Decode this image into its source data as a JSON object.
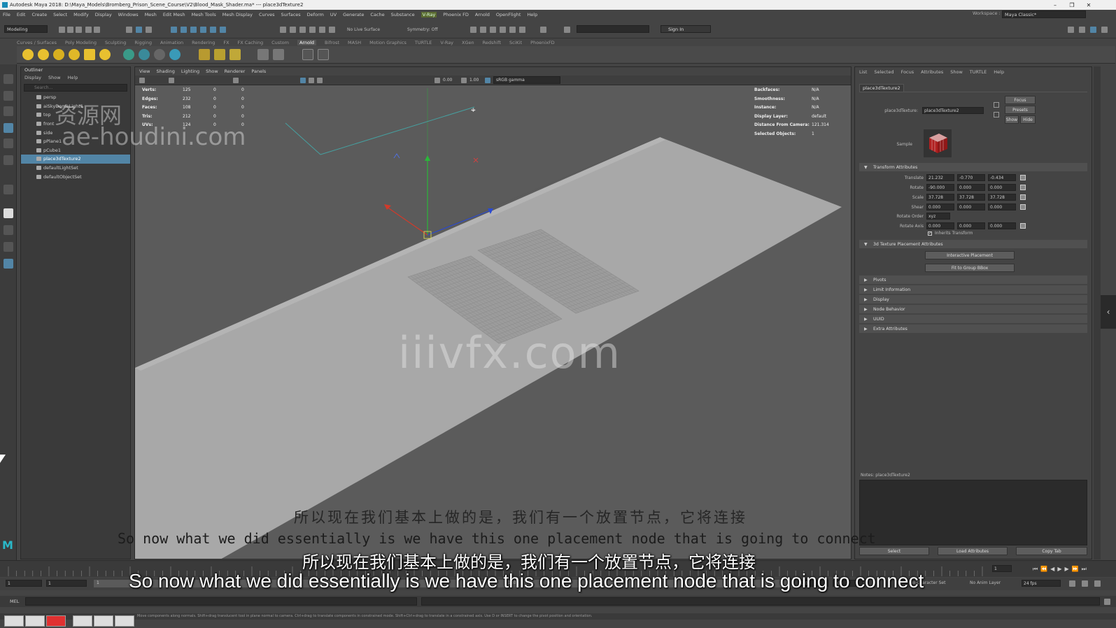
{
  "window": {
    "title": "Autodesk Maya 2018: D:\\Maya_Models\\Bromberg_Prison_Scene_Course\\V2\\Blood_Mask_Shader.ma*   ---   place3dTexture2"
  },
  "menubar": {
    "items": [
      "File",
      "Edit",
      "Create",
      "Select",
      "Modify",
      "Display",
      "Windows",
      "Mesh",
      "Edit Mesh",
      "Mesh Tools",
      "Mesh Display",
      "Curves",
      "Surfaces",
      "Deform",
      "UV",
      "Generate",
      "Cache",
      "Substance",
      "V-Ray",
      "Phoenix FD",
      "Arnold",
      "OpenFlight",
      "Help"
    ],
    "workspace_label": "Workspace :",
    "workspace_value": "Maya Classic*"
  },
  "toolbar": {
    "mode": "Modeling",
    "live_surface": "No Live Surface",
    "symmetry": "Symmetry: Off",
    "sign_in": "Sign In"
  },
  "shelf_tabs": [
    "Curves / Surfaces",
    "Poly Modeling",
    "Sculpting",
    "Rigging",
    "Animation",
    "Rendering",
    "FX",
    "FX Caching",
    "Custom",
    "Arnold",
    "Bifrost",
    "MASH",
    "Motion Graphics",
    "TURTLE",
    "V-Ray",
    "XGen",
    "Redshift",
    "SciKit",
    "PhoenixFD"
  ],
  "shelf_active": "Arnold",
  "outliner": {
    "title": "Outliner",
    "menu": [
      "Display",
      "Show",
      "Help"
    ],
    "search_placeholder": "Search...",
    "items": [
      "persp",
      "aiSkyDomeLight1",
      "top",
      "front",
      "side",
      "pPlane1",
      "pCube1",
      "place3dTexture2",
      "defaultLightSet",
      "defaultObjectSet"
    ],
    "selected": "place3dTexture2"
  },
  "viewport": {
    "menu": [
      "View",
      "Shading",
      "Lighting",
      "Show",
      "Renderer",
      "Panels"
    ],
    "exposure": "0.00",
    "gamma": "1.00",
    "color_space": "sRGB gamma",
    "hud_left": {
      "labels": [
        "Verts:",
        "Edges:",
        "Faces:",
        "Tris:",
        "UVs:"
      ],
      "col1": [
        "125",
        "232",
        "108",
        "212",
        "124"
      ],
      "col2": [
        "0",
        "0",
        "0",
        "0",
        "0"
      ],
      "col3": [
        "0",
        "0",
        "0",
        "0",
        "0"
      ]
    },
    "hud_right": {
      "labels": [
        "Backfaces:",
        "Smoothness:",
        "Instance:",
        "Display Layer:",
        "Distance From Camera:",
        "Selected Objects:"
      ],
      "values": [
        "N/A",
        "N/A",
        "N/A",
        "default",
        "121.314",
        "1"
      ]
    }
  },
  "watermarks": {
    "cn_site": "资源网",
    "site1": "ae-houdini.com",
    "site2": "iiivfx.com"
  },
  "attribute_editor": {
    "menu": [
      "List",
      "Selected",
      "Focus",
      "Attributes",
      "Show",
      "TURTLE",
      "Help"
    ],
    "tab": "place3dTexture2",
    "node_label": "place3dTexture:",
    "node_value": "place3dTexture2",
    "focus": "Focus",
    "presets": "Presets",
    "show": "Show",
    "hide": "Hide",
    "sample_label": "Sample",
    "transform_section": "Transform Attributes",
    "translate_label": "Translate",
    "translate": [
      "21.232",
      "-0.770",
      "-0.434"
    ],
    "rotate_label": "Rotate",
    "rotate": [
      "-90.000",
      "0.000",
      "0.000"
    ],
    "scale_label": "Scale",
    "scale": [
      "37.728",
      "37.728",
      "37.728"
    ],
    "shear_label": "Shear",
    "shear": [
      "0.000",
      "0.000",
      "0.000"
    ],
    "rotate_order_label": "Rotate Order",
    "rotate_order": "xyz",
    "rotate_axis_label": "Rotate Axis",
    "rotate_axis": [
      "0.000",
      "0.000",
      "0.000"
    ],
    "inherits_transform": "Inherits Transform",
    "placement_section": "3d Texture Placement Attributes",
    "interactive_placement": "Interactive Placement",
    "fit_to_group": "Fit to Group BBox",
    "collapsed_sections": [
      "Pivots",
      "Limit Information",
      "Display",
      "Node Behavior",
      "UUID",
      "Extra Attributes"
    ],
    "notes_label": "Notes: place3dTexture2",
    "select_btn": "Select",
    "load_attrs_btn": "Load Attributes",
    "copy_tab_btn": "Copy Tab"
  },
  "timeline": {
    "current_frame": "1",
    "range_start": "1",
    "range_inner_start": "1",
    "range_inner_end": "120",
    "range_end": "120",
    "range_end2": "200",
    "char_set": "No Character Set",
    "anim_layer": "No Anim Layer",
    "fps": "24 fps"
  },
  "cmdline": {
    "label": "MEL"
  },
  "helpline": {
    "text": "Move components along normals. Shift+drag translucent tool in plane normal to camera. Ctrl+drag to translate components in constrained mode. Shift+Ctrl+drag to translate in a constrained axis. Use D or INSERT to change the pivot position and orientation."
  },
  "subtitles": {
    "cn_top": "所以现在我们基本上做的是，我们有一个放置节点，它将连接",
    "en_top": "So now what we did essentially is we have this one placement node that is going to connect",
    "cn_bottom": "所以现在我们基本上做的是，我们有一个放置节点，它将连接",
    "en_bottom": "So now what we did essentially is we have this one placement node that is going to connect"
  },
  "colors": {
    "selection": "#5285a6",
    "viewport_bg": "#5b5b5b",
    "plane": "#a9a9a9",
    "axis_x": "#d23a2a",
    "axis_y": "#2ab83a",
    "axis_z": "#2a4ad2"
  }
}
